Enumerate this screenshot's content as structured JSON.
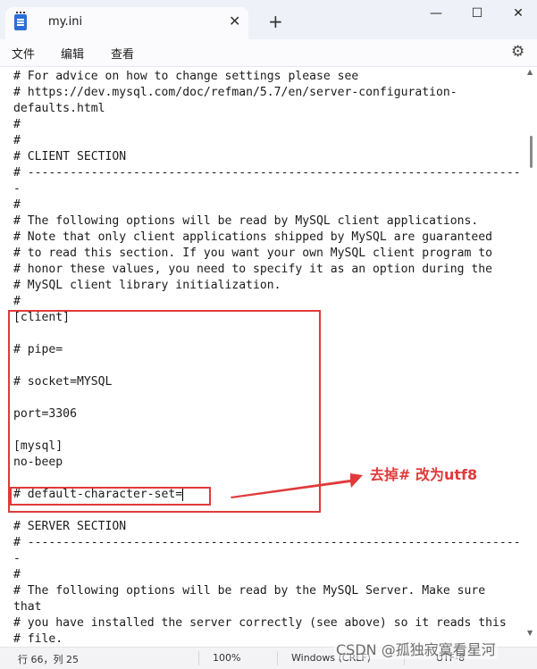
{
  "window": {
    "tab_title": "my.ini",
    "tab_close": "✕",
    "new_tab": "+",
    "minimize": "—",
    "maximize": "☐",
    "close": "✕"
  },
  "menu": {
    "items": [
      "文件",
      "编辑",
      "查看"
    ],
    "settings_icon": "⚙"
  },
  "editor": {
    "lines": [
      "# For advice on how to change settings please see",
      "# https://dev.mysql.com/doc/refman/5.7/en/server-configuration-",
      "defaults.html",
      "#",
      "#",
      "# CLIENT SECTION",
      "# ----------------------------------------------------------------------",
      "-",
      "#",
      "# The following options will be read by MySQL client applications.",
      "# Note that only client applications shipped by MySQL are guaranteed",
      "# to read this section. If you want your own MySQL client program to",
      "# honor these values, you need to specify it as an option during the",
      "# MySQL client library initialization.",
      "#",
      "[client]",
      "",
      "# pipe=",
      "",
      "# socket=MYSQL",
      "",
      "port=3306",
      "",
      "[mysql]",
      "no-beep",
      "",
      "# default-character-set=",
      "",
      "# SERVER SECTION",
      "# ----------------------------------------------------------------------",
      "-",
      "#",
      "# The following options will be read by the MySQL Server. Make sure",
      "that",
      "# you have installed the server correctly (see above) so it reads this",
      "# file."
    ],
    "caret_line_index": 26
  },
  "annotation": {
    "text": "去掉# 改为utf8",
    "color": "#e03a3a"
  },
  "status": {
    "position": "行 66，列 25",
    "zoom": "100%",
    "line_ending": "Windows (CRLF)",
    "encoding": "UTF-8"
  },
  "watermark": "CSDN @孤独寂寞看星河"
}
